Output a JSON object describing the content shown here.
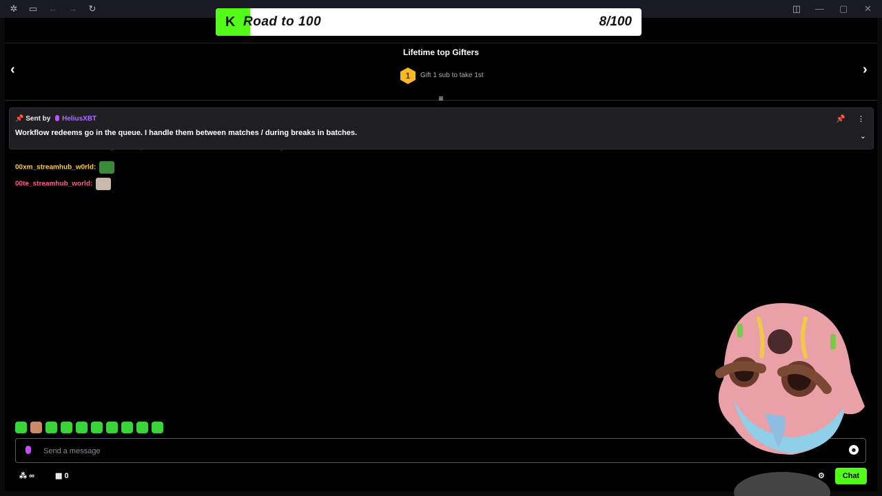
{
  "banner": {
    "title": "Road to 100",
    "count": "8/100",
    "logo": "K",
    "progress": 0.08,
    "fill_color": "#53fc18"
  },
  "gifters": {
    "title": "Lifetime top Gifters",
    "rank": "1",
    "rank_text": "Gift 1 sub to take 1st"
  },
  "pinned": {
    "sent_by": "Sent by",
    "username": "HeliusXBT",
    "message": "Workflow redeems go in the queue. I handle them between matches / during breaks in batches."
  },
  "ghost_line": "HeliusXBT: Workflow redeems go in the queue. I handle them between matches / during breaks in batches.",
  "messages": [
    {
      "user": "00xm_streamhub_w0rld:",
      "color": "#f7c948"
    },
    {
      "user": "00te_streamhub_world:",
      "color": "#ff5a8a"
    }
  ],
  "input": {
    "placeholder": "Send a message"
  },
  "bottom": {
    "points": "∞",
    "store_count": "0",
    "chat_button": "Chat"
  },
  "colors": {
    "accent": "#53fc18",
    "username_purple": "#b06cff"
  }
}
